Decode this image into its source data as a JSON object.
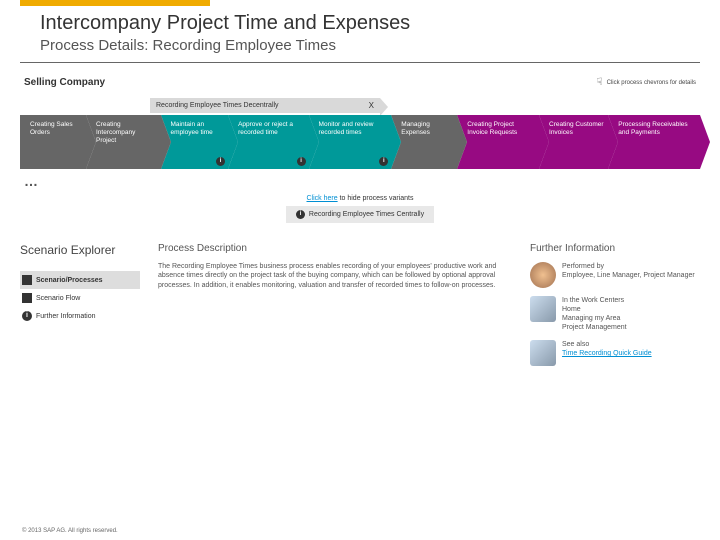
{
  "header": {
    "title": "Intercompany Project Time and Expenses",
    "subtitle": "Process Details: Recording Employee Times"
  },
  "selling_company": "Selling Company",
  "hint": "Click process chevrons for details",
  "group_label": "Recording Employee Times Decentrally",
  "group_close": "X",
  "steps": [
    {
      "label": "Creating Sales Orders",
      "cls": "c-dark",
      "info": false
    },
    {
      "label": "Creating Intercompany Project",
      "cls": "c-dark",
      "info": false
    },
    {
      "label": "Maintain an employee time",
      "cls": "c-teal",
      "info": true
    },
    {
      "label": "Approve or reject a recorded time",
      "cls": "c-teal",
      "info": true
    },
    {
      "label": "Monitor and review recorded times",
      "cls": "c-teal",
      "info": true
    },
    {
      "label": "Managing Expenses",
      "cls": "c-dark",
      "info": false
    },
    {
      "label": "Creating Project Invoice Requests",
      "cls": "c-mag",
      "info": false
    },
    {
      "label": "Creating Customer Invoices",
      "cls": "c-mag",
      "info": false
    },
    {
      "label": "Processing Receivables and Payments",
      "cls": "c-mag",
      "info": false
    }
  ],
  "variants": {
    "link": "Click here",
    "rest": " to hide process variants"
  },
  "variant_box": "Recording Employee Times Centrally",
  "nav": {
    "title": "Scenario Explorer",
    "items": [
      {
        "label": "Scenario/Processes",
        "sel": true,
        "icon": "double"
      },
      {
        "label": "Scenario Flow",
        "sel": false,
        "icon": "square"
      },
      {
        "label": "Further Information",
        "sel": false,
        "icon": "info"
      }
    ]
  },
  "desc": {
    "title": "Process Description",
    "body": "The Recording Employee Times business process enables recording of your employees' productive work and absence times directly on the project task of the buying company, which can be followed by optional approval processes. In addition, it enables monitoring, valuation and transfer of recorded times to follow-on processes."
  },
  "fi": {
    "title": "Further Information",
    "rows": [
      {
        "text": "Performed by\nEmployee, Line Manager, Project Manager"
      },
      {
        "text": "In the Work Centers\nHome\nManaging my Area\nProject Management"
      },
      {
        "text": "See also",
        "link": "Time Recording Quick Guide"
      }
    ]
  },
  "copyright": "© 2013 SAP AG. All rights reserved."
}
